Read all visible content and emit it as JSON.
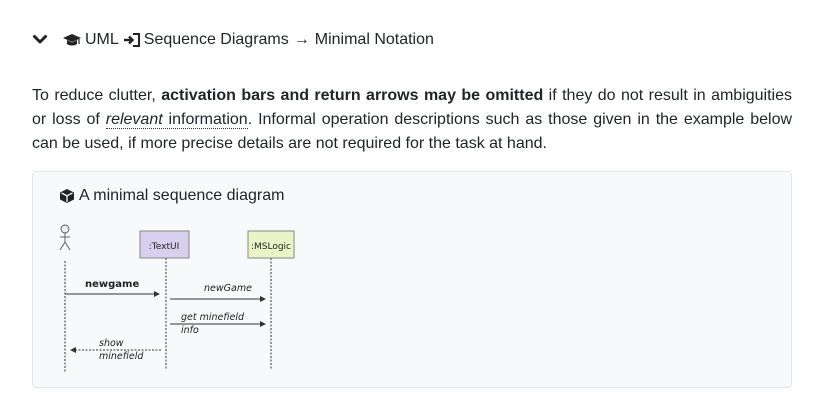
{
  "header": {
    "crumb1": "UML",
    "crumb2": "Sequence Diagrams",
    "crumb3": "Minimal Notation"
  },
  "paragraph": {
    "part1": "To reduce clutter, ",
    "bold": "activation bars and return arrows may be omitted",
    "part2": " if they do not result in ambiguities or loss of ",
    "relevant": "relevant",
    "information": " information",
    "part3": ". Informal operation descriptions such as those given in the example below can be used, if more precise details are not required for the task at hand."
  },
  "panel": {
    "title": "A minimal sequence diagram"
  },
  "diagram": {
    "lifeline1": ":TextUI",
    "lifeline2": ":MSLogic",
    "msg1": "newgame",
    "msg2": "newGame",
    "msg3a": "get minefield",
    "msg3b": "info",
    "ret1a": "show",
    "ret1b": "minefield"
  }
}
